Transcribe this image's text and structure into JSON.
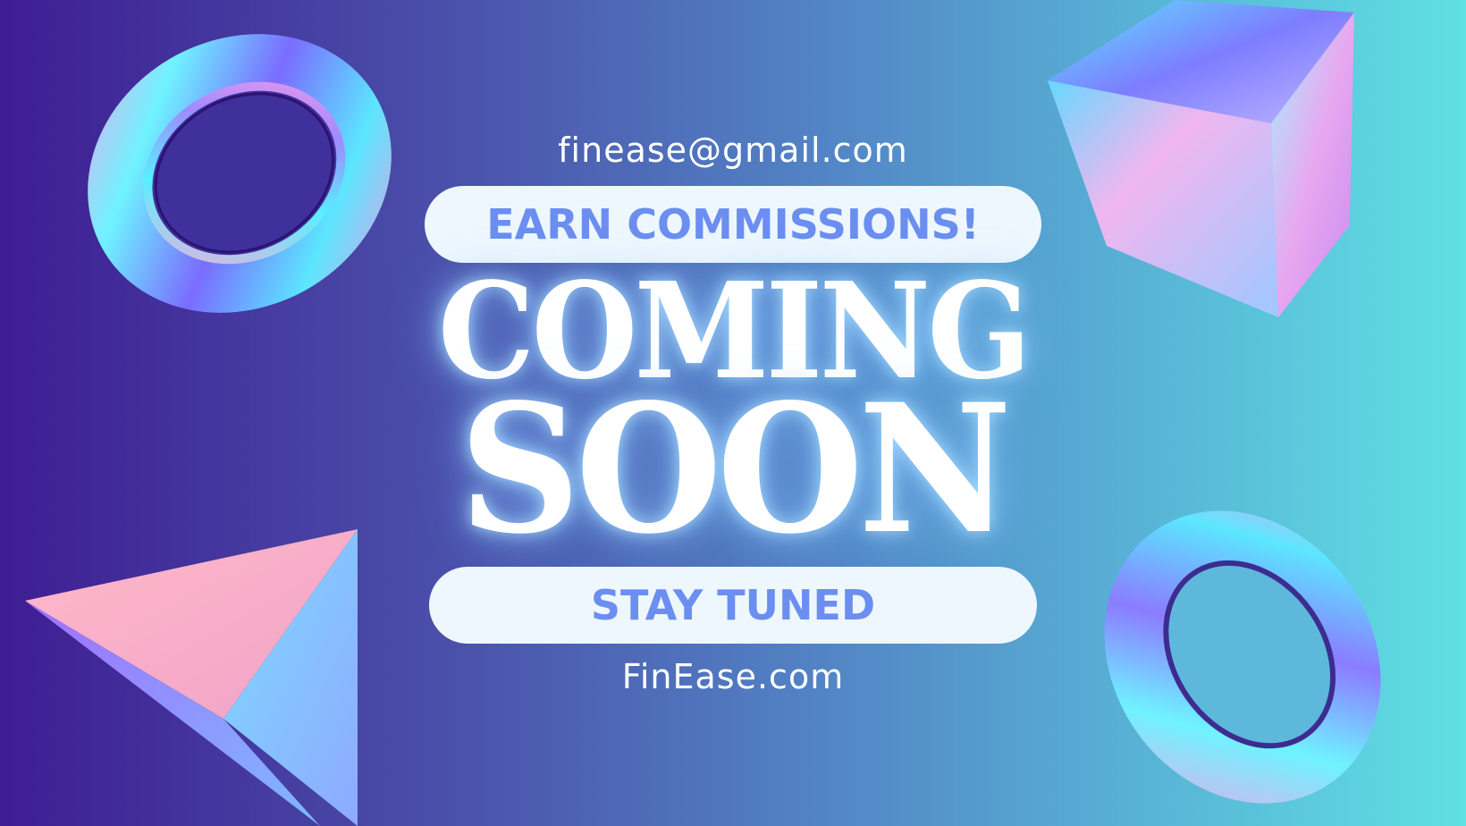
{
  "contact": {
    "email": "finease@gmail.com",
    "website": "FinEase.com"
  },
  "banner": {
    "top_pill": "EARN COMMISSIONS!",
    "headline_line1": "COMING",
    "headline_line2": "SOON",
    "bottom_pill": "STAY TUNED"
  },
  "decorations": {
    "shapes": [
      "holographic-torus",
      "holographic-cube",
      "holographic-pyramid",
      "holographic-torus"
    ]
  },
  "colors": {
    "background_left": "#3e1d93",
    "background_right": "#5fe0e3",
    "pill_background": "#eef7fe",
    "pill_text": "#6b8ef0",
    "headline": "#ffffff"
  }
}
